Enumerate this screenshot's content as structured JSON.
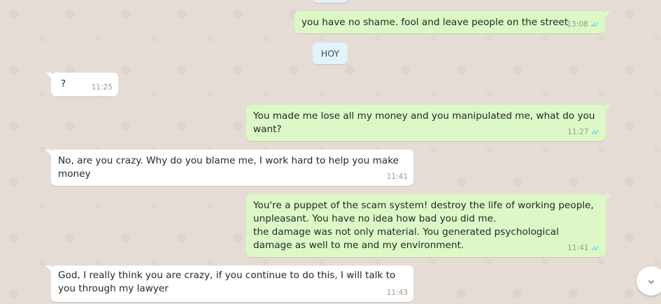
{
  "messages": [
    {
      "direction": "out",
      "text": "you have no shame. fool and leave people on the street",
      "time": "13:08",
      "status": "read"
    },
    {
      "direction": "in",
      "text": "?",
      "time": "11:25"
    },
    {
      "direction": "out",
      "text": "You made me lose all my money and you manipulated me, what do you want?",
      "time": "11:27",
      "status": "read"
    },
    {
      "direction": "in",
      "text": "No, are you crazy. Why do you blame me, I work hard to help you make money",
      "time": "11:41"
    },
    {
      "direction": "out",
      "text": "You're a puppet of the scam system! destroy the life of working people, unpleasant. You have no idea how bad you did me.\nthe damage was not only material. You generated psychological damage as well to me and my environment.",
      "time": "11:41",
      "status": "read"
    },
    {
      "direction": "in",
      "text": "God, I really think you are crazy, if you continue to do this, I will talk to you through my lawyer",
      "time": "11:43"
    }
  ],
  "date_divider": {
    "label": "HOY"
  },
  "scroll_button": {
    "icon": "chevron-down-icon",
    "glyph": "⌄"
  },
  "colors": {
    "outgoing_bubble": "#dcf8c6",
    "incoming_bubble": "#ffffff",
    "chat_background": "#e5ddd5",
    "read_ticks": "#4fc3f7",
    "divider_bg": "#e1f3fb"
  }
}
